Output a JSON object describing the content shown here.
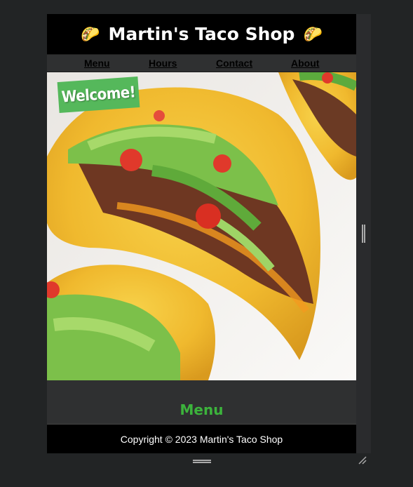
{
  "header": {
    "title": "Martin's Taco Shop",
    "left_icon": "taco-emoji",
    "right_icon": "taco-emoji",
    "icon_glyph": "🌮"
  },
  "nav": {
    "items": [
      {
        "label": "Menu"
      },
      {
        "label": "Hours"
      },
      {
        "label": "Contact"
      },
      {
        "label": "About"
      }
    ]
  },
  "hero": {
    "badge": "Welcome!",
    "image": "tacos-photo",
    "badge_color": "#55b85b"
  },
  "menu_section": {
    "heading": "Menu",
    "heading_color": "#3cb33c"
  },
  "footer": {
    "copyright": "Copyright © 2023 Martin's Taco Shop"
  },
  "colors": {
    "background": "#222425",
    "header_bg": "#000000",
    "page_bg": "#2f3031"
  }
}
